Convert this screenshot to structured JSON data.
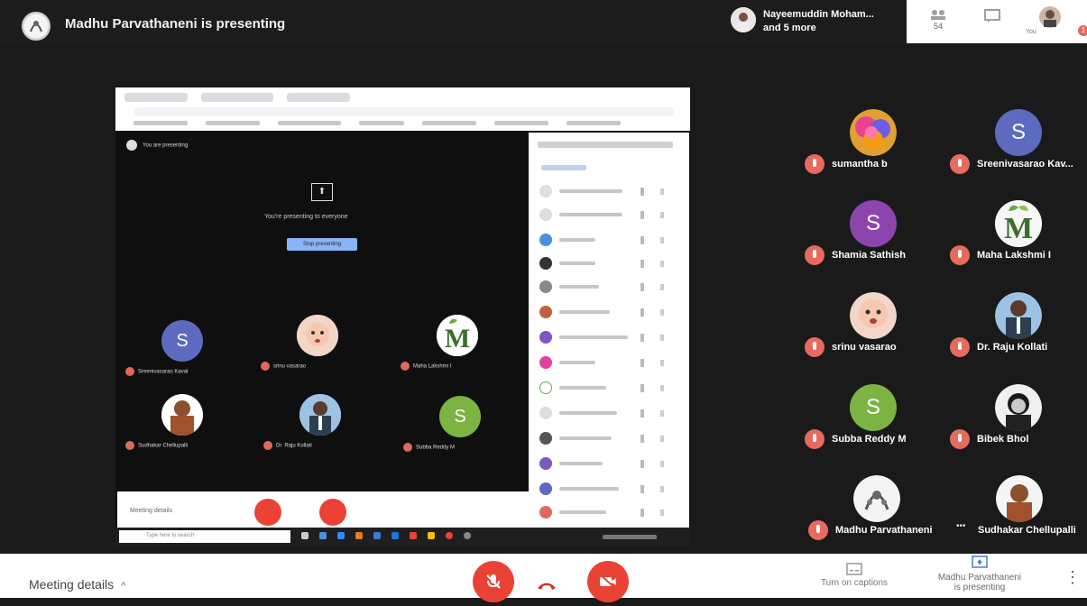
{
  "header": {
    "title": "Madhu Parvathaneni is presenting",
    "people_line1": "Nayeemuddin Moham...",
    "people_line2": "and 5 more",
    "right_icons": [
      {
        "icon": "people-icon",
        "label": "54"
      },
      {
        "icon": "chat-icon",
        "label": ""
      },
      {
        "icon": "avatar",
        "label": "You"
      }
    ],
    "badge": "1"
  },
  "shared_screen": {
    "presenting_note": "You are presenting",
    "message": "You're presenting to everyone",
    "stop_label": "Stop presenting",
    "tiles": [
      {
        "initial": "S",
        "name": "Sreenivasarao Kaval"
      },
      {
        "initial": "",
        "name": "srinu vasarao"
      },
      {
        "initial": "",
        "name": "Maha Lakshmi I"
      },
      {
        "initial": "",
        "name": "Sudhakar Chellupalli"
      },
      {
        "initial": "",
        "name": "Dr. Raju Kollati"
      },
      {
        "initial": "S",
        "name": "Subba Reddy M"
      }
    ],
    "taskbar_search": "Type here to search",
    "meet_text": "Meeting details"
  },
  "participants": [
    {
      "name": "sumantha b",
      "initial": "",
      "color": "#e0a030",
      "kind": "image"
    },
    {
      "name": "Sreenivasarao Kav...",
      "initial": "S",
      "color": "#5c6bc0",
      "kind": "letter"
    },
    {
      "name": "Shamia Sathish",
      "initial": "S",
      "color": "#8e44ad",
      "kind": "letter"
    },
    {
      "name": "Maha Lakshmi I",
      "initial": "M",
      "color": "#f5f5f5",
      "kind": "logo"
    },
    {
      "name": "srinu vasarao",
      "initial": "",
      "color": "#f0c8b0",
      "kind": "image"
    },
    {
      "name": "Dr. Raju Kollati",
      "initial": "",
      "color": "#9cc3e6",
      "kind": "image"
    },
    {
      "name": "Subba Reddy M",
      "initial": "S",
      "color": "#7cb342",
      "kind": "letter"
    },
    {
      "name": "Bibek Bhol",
      "initial": "",
      "color": "#e0e0e0",
      "kind": "image"
    },
    {
      "name": "Madhu Parvathaneni",
      "initial": "",
      "color": "#e8e8e8",
      "kind": "image"
    },
    {
      "name": "Sudhakar Chellupalli",
      "initial": "",
      "color": "#b07050",
      "kind": "image"
    }
  ],
  "more_dots": "•••",
  "bottom": {
    "meeting_details": "Meeting details",
    "chevron": "^",
    "captions": "Turn on captions",
    "presenting_line1": "Madhu Parvathaneni",
    "presenting_line2": "is presenting",
    "kebab": "⋮"
  }
}
